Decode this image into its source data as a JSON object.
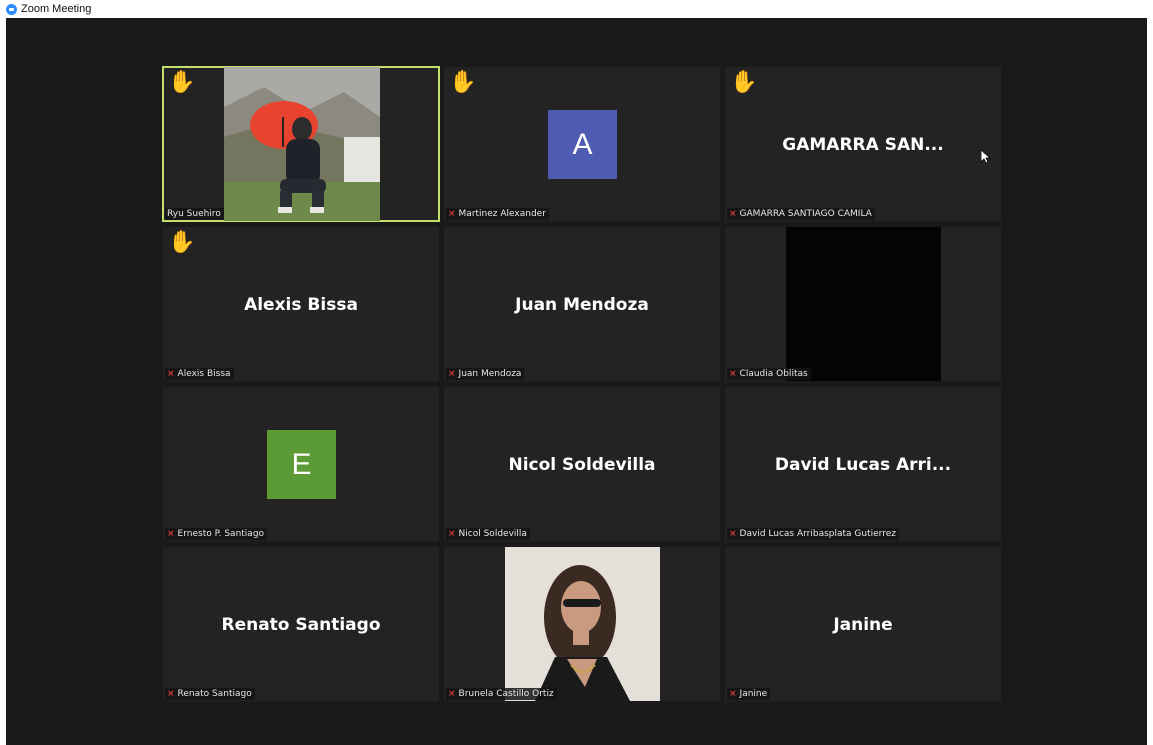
{
  "window": {
    "title": "Zoom Meeting"
  },
  "colors": {
    "stage_bg": "#1a1a1a",
    "tile_bg": "#232323",
    "active_border": "#c3e06b",
    "muted": "#e23a3a"
  },
  "participants": [
    {
      "label": "Ryu Suehiro",
      "display": "",
      "hand": "✋",
      "muted": false,
      "active": true
    },
    {
      "label": "Martinez Alexander",
      "display": "A",
      "hand": "✋",
      "muted": true,
      "avatar_color": "#4e5bb0"
    },
    {
      "label": "GAMARRA SANTIAGO CAMILA",
      "display": "GAMARRA  SAN...",
      "hand": "✋",
      "muted": true
    },
    {
      "label": "Alexis Bissa",
      "display": "Alexis Bissa",
      "hand": "✋",
      "muted": true
    },
    {
      "label": "Juan Mendoza",
      "display": "Juan Mendoza",
      "muted": true
    },
    {
      "label": "Claudia Oblitas",
      "display": "",
      "muted": true
    },
    {
      "label": "Ernesto P. Santiago",
      "display": "E",
      "muted": true,
      "avatar_color": "#5b9a34"
    },
    {
      "label": "Nicol Soldevilla",
      "display": "Nicol Soldevilla",
      "muted": true
    },
    {
      "label": "David Lucas Arribasplata Gutierrez",
      "display": "David  Lucas  Arri...",
      "muted": true
    },
    {
      "label": "Renato Santiago",
      "display": "Renato Santiago",
      "muted": true
    },
    {
      "label": "Brunela Castillo Ortiz",
      "display": "",
      "muted": true
    },
    {
      "label": "Janine",
      "display": "Janine",
      "muted": true
    }
  ]
}
